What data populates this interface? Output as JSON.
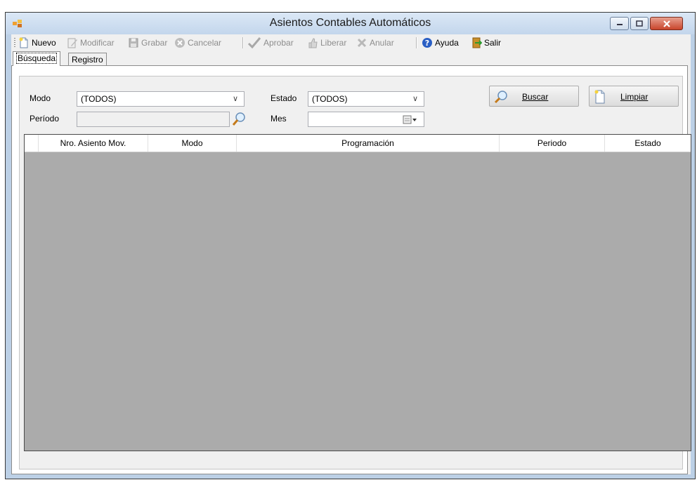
{
  "window": {
    "title": "Asientos Contables Automáticos"
  },
  "toolbar": {
    "nuevo": "Nuevo",
    "modificar": "Modificar",
    "grabar": "Grabar",
    "cancelar": "Cancelar",
    "aprobar": "Aprobar",
    "liberar": "Liberar",
    "anular": "Anular",
    "ayuda": "Ayuda",
    "salir": "Salir"
  },
  "tabs": [
    {
      "label": "Búsqueda",
      "active": true
    },
    {
      "label": "Registro",
      "active": false
    }
  ],
  "filters": {
    "modo_label": "Modo",
    "modo_value": "(TODOS)",
    "estado_label": "Estado",
    "estado_value": "(TODOS)",
    "periodo_label": "Período",
    "periodo_value": "",
    "mes_label": "Mes",
    "mes_value": ""
  },
  "buttons": {
    "buscar": "Buscar",
    "limpiar": "Limpiar"
  },
  "grid": {
    "columns": [
      "Nro. Asiento Mov.",
      "Modo",
      "Programación",
      "Periodo",
      "Estado"
    ],
    "rows": []
  },
  "colors": {
    "grid_background": "#ababab",
    "window_frame": "#bcd0e6",
    "close_button": "#c9452c"
  }
}
